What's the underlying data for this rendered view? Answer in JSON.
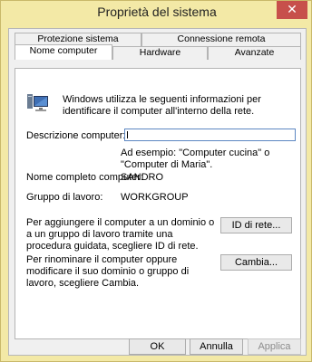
{
  "window": {
    "title": "Proprietà del sistema"
  },
  "tabs": {
    "top_row": [
      "Protezione sistema",
      "Connessione remota"
    ],
    "bottom_row": [
      "Nome computer",
      "Hardware",
      "Avanzate"
    ]
  },
  "panel": {
    "intro": "Windows utilizza le seguenti informazioni per identificare il computer all'interno della rete.",
    "descrizione_label": "Descrizione computer:",
    "descrizione_value": "",
    "example": "Ad esempio: \"Computer cucina\" o \"Computer di Maria\".",
    "fullname_label": "Nome completo computer:",
    "fullname_value": "SANDRO",
    "workgroup_label": "Gruppo di lavoro:",
    "workgroup_value": "WORKGROUP",
    "network_text": "Per aggiungere il computer a un dominio o a un gruppo di lavoro tramite una procedura guidata, scegliere ID di rete.",
    "network_button": "ID di rete...",
    "rename_text": "Per rinominare il computer oppure modificare il suo dominio o gruppo di lavoro, scegliere Cambia.",
    "rename_button": "Cambia..."
  },
  "buttons": {
    "ok": "OK",
    "cancel": "Annulla",
    "apply": "Applica"
  },
  "icons": {
    "close": "close-icon",
    "computer": "computer-icon"
  }
}
